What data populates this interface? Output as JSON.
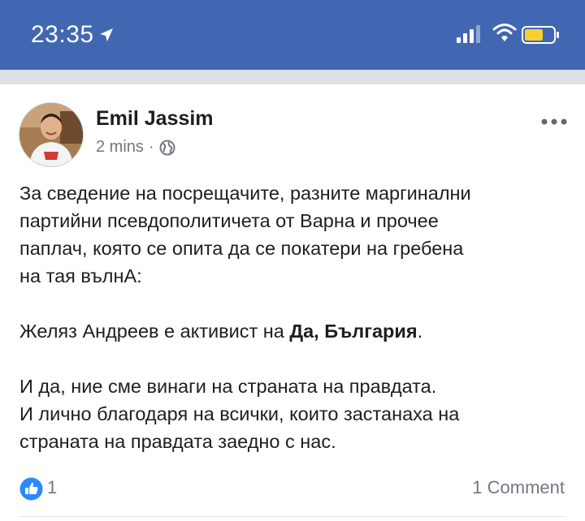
{
  "status_bar": {
    "time": "23:35",
    "location_icon": "location-arrow-icon",
    "signal_icon": "cellular-signal-icon",
    "wifi_icon": "wifi-icon",
    "battery_icon": "battery-icon",
    "color": "#4267b2",
    "battery_color": "#f5d130"
  },
  "post": {
    "author": "Emil Jassim",
    "time": "2 mins",
    "separator": "·",
    "privacy_icon": "globe-icon",
    "more_icon": "more-dots-icon",
    "paragraph1": [
      "За сведение на посрещачите, разните маргинални",
      "партийни псевдополитичета от Варна и прочее",
      "паплач,  която се опита да се покатери на гребена",
      "на  тая вълнА:"
    ],
    "paragraph2": {
      "prefix": "Желяз Андреев е активист на ",
      "bold": "Да, България",
      "suffix": "."
    },
    "paragraph3": [
      "И да, ние сме винаги на страната на правдата.",
      "И лично благодаря на всички, които застанаха  на",
      "страната на правдата заедно с нас."
    ],
    "reactions": {
      "icon": "like-thumb-icon",
      "count": "1",
      "comments": "1 Comment"
    }
  }
}
